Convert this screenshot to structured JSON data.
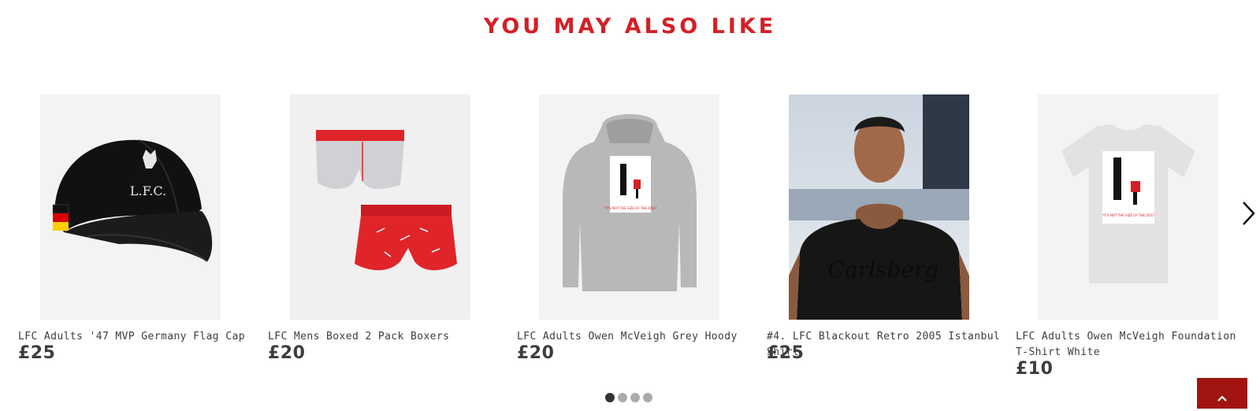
{
  "section": {
    "title": "YOU MAY ALSO LIKE"
  },
  "products": [
    {
      "name": "LFC Adults '47 MVP Germany Flag Cap",
      "price": "£25",
      "image": "black-cap-with-germany-flag"
    },
    {
      "name": "LFC Mens Boxed 2 Pack Boxers",
      "price": "£20",
      "image": "grey-and-red-boxers"
    },
    {
      "name": "LFC Adults Owen McVeigh Grey Hoody",
      "price": "£20",
      "image": "grey-hoody-print"
    },
    {
      "name": "#4. LFC Blackout Retro 2005 Istanbul Shirt",
      "price": "£25",
      "image": "model-black-shirt"
    },
    {
      "name": "LFC Adults Owen McVeigh Foundation T-Shirt White",
      "price": "£10",
      "image": "white-tshirt-print"
    }
  ],
  "carousel": {
    "page_count": 4,
    "active_page": 1
  },
  "icons": {
    "next": "chevron-right-icon",
    "back_to_top": "chevron-up-icon"
  },
  "colors": {
    "accent": "#d32026",
    "back_to_top_bg": "#a1140f",
    "text": "#3d3d3d"
  }
}
